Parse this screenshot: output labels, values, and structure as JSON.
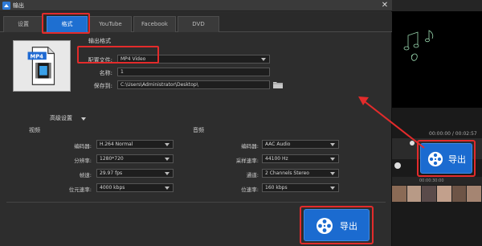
{
  "window": {
    "title": "输出",
    "close_glyph": "✕"
  },
  "tabs": [
    {
      "label": "设置",
      "active": false
    },
    {
      "label": "格式",
      "active": true
    },
    {
      "label": "YouTube",
      "active": false
    },
    {
      "label": "Facebook",
      "active": false
    },
    {
      "label": "DVD",
      "active": false
    }
  ],
  "file_icon": {
    "badge": "MP4"
  },
  "output_settings": {
    "heading": "输出格式",
    "profile_label": "配置文件:",
    "profile_value": "MP4 Video",
    "name_label": "名称:",
    "name_value": "1",
    "save_label": "保存到:",
    "save_value": "C:\\Users\\Administrator\\Desktop\\"
  },
  "advanced": {
    "label": "高级设置"
  },
  "video": {
    "heading": "视频",
    "encoder_label": "编码器:",
    "encoder_value": "H.264 Normal",
    "resolution_label": "分辨率:",
    "resolution_value": "1280*720",
    "framerate_label": "帧速:",
    "framerate_value": "29.97 fps",
    "bitrate_label": "位元速率:",
    "bitrate_value": "4000 kbps"
  },
  "audio": {
    "heading": "音频",
    "encoder_label": "编码器:",
    "encoder_value": "AAC Audio",
    "samplerate_label": "采样速率:",
    "samplerate_value": "44100 Hz",
    "channels_label": "通道:",
    "channels_value": "2 Channels Stereo",
    "bitrate_label": "位速率:",
    "bitrate_value": "160 kbps"
  },
  "export_main": {
    "label": "导出"
  },
  "editor": {
    "timecode": "00:00:00 / 00:02:57",
    "ruler_time": "00:00:30:00",
    "export_label": "导出"
  },
  "colors": {
    "accent": "#1b6bd0",
    "highlight": "#e32b2b",
    "panel": "#2d2d2d"
  },
  "icons": [
    "app-icon",
    "close-icon",
    "mp4-file-icon",
    "folder-icon",
    "film-reel-icon",
    "caret-down-icon"
  ]
}
